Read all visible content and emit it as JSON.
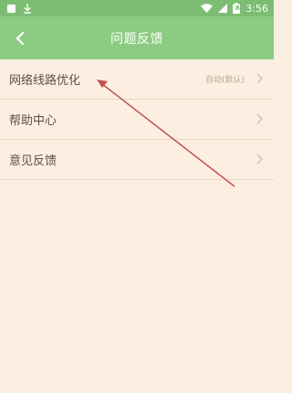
{
  "status_bar": {
    "time": "3:56",
    "battery_level": "8",
    "icons": [
      "notification-square-icon",
      "download-icon",
      "wifi-icon",
      "cellular-signal-icon",
      "battery-icon"
    ]
  },
  "app_bar": {
    "title": "问题反馈",
    "back_icon": "chevron-left-icon",
    "background": "#8ccb82"
  },
  "menu": {
    "items": [
      {
        "label": "网络线路优化",
        "value": "自动(默认)"
      },
      {
        "label": "帮助中心",
        "value": ""
      },
      {
        "label": "意见反馈",
        "value": ""
      }
    ]
  },
  "colors": {
    "page_background": "#fcefe1",
    "status_bar": "#7cbd73",
    "annotation_arrow": "#c0504d"
  }
}
